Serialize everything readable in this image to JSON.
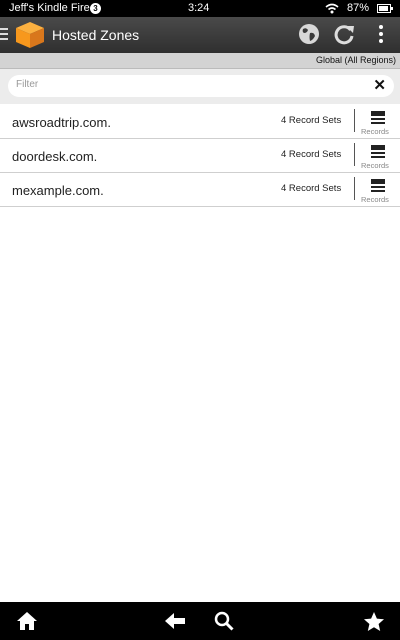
{
  "status_bar": {
    "device_name": "Jeff's Kindle Fire",
    "notification_count": "3",
    "time": "3:24",
    "battery_percent": "87%",
    "battery_level": 0.87
  },
  "app_bar": {
    "title": "Hosted Zones",
    "icons": [
      "menu-icon",
      "aws-cube-logo",
      "globe-icon",
      "refresh-icon",
      "overflow-menu-icon"
    ]
  },
  "region": {
    "label": "Global (All Regions)"
  },
  "filter": {
    "placeholder": "Filter",
    "value": ""
  },
  "zones": [
    {
      "name": "awsroadtrip.com.",
      "record_sets": "4 Record Sets",
      "records_label": "Records"
    },
    {
      "name": "doordesk.com.",
      "record_sets": "4 Record Sets",
      "records_label": "Records"
    },
    {
      "name": "mexample.com.",
      "record_sets": "4 Record Sets",
      "records_label": "Records"
    }
  ],
  "nav_bar": {
    "icons": [
      "home-icon",
      "back-icon",
      "search-icon",
      "favorites-icon"
    ]
  },
  "colors": {
    "logo_orange": "#f7981d",
    "app_bar": "#3a3a3a",
    "region_bar": "#d3d3d3"
  }
}
